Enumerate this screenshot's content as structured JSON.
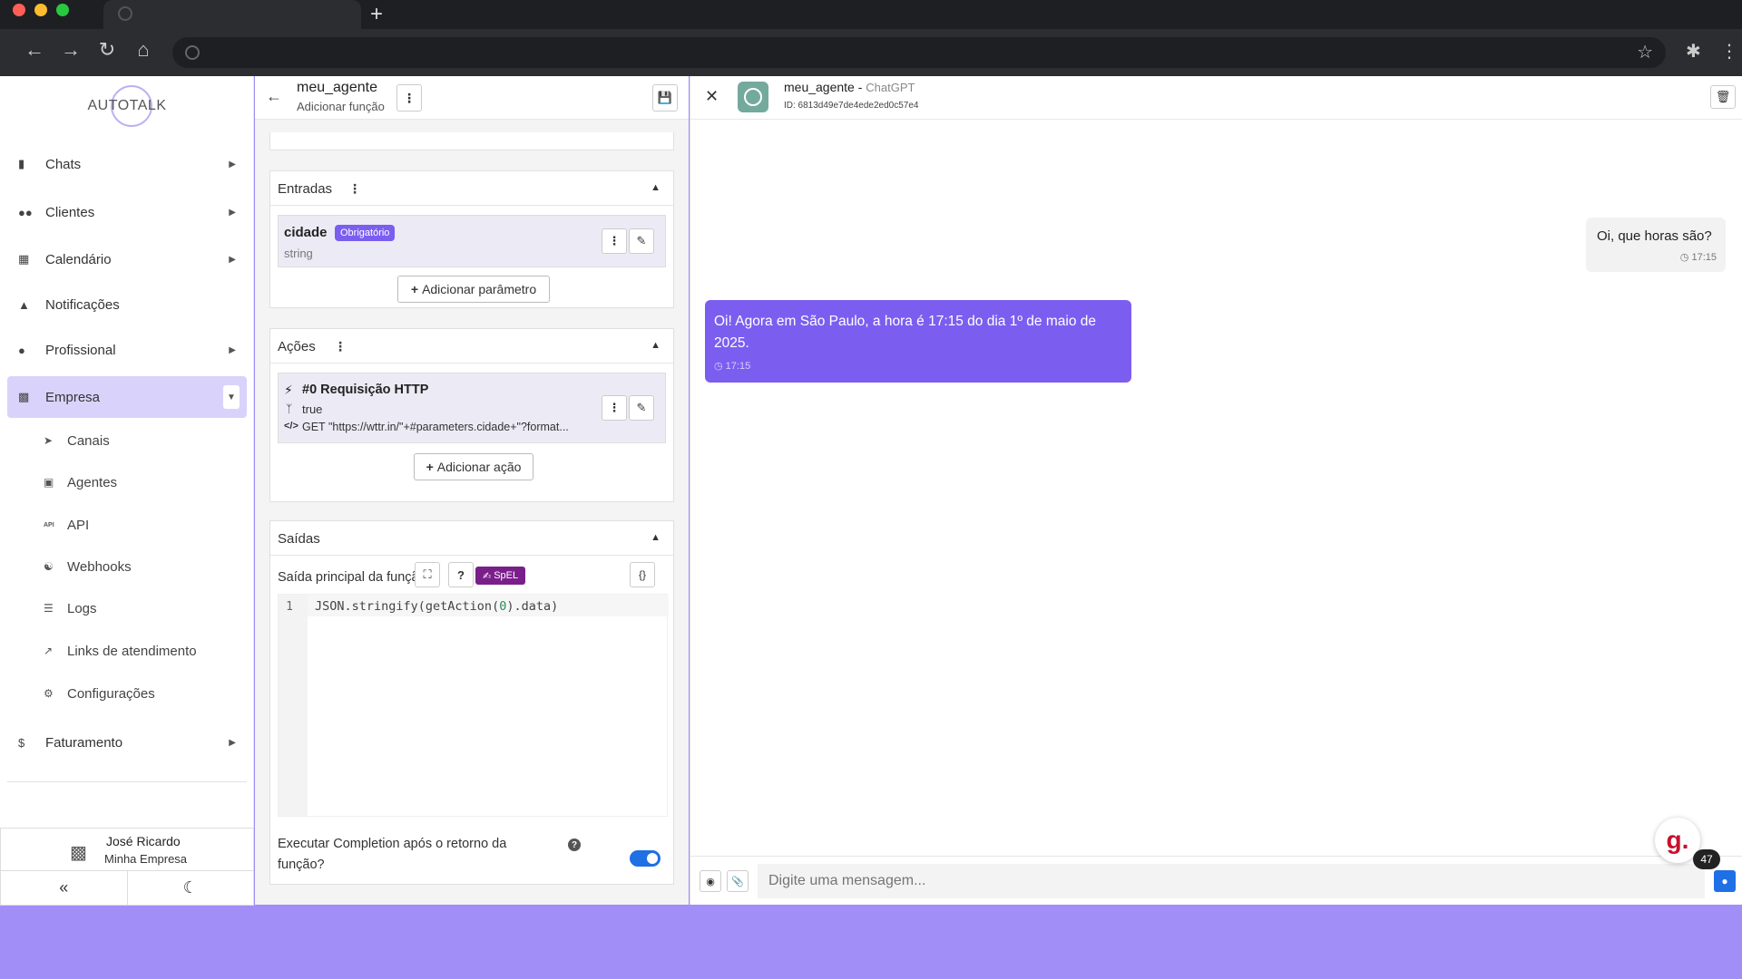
{
  "browser": {
    "icons": [
      "back-icon",
      "forward-icon",
      "reload-icon",
      "home-icon",
      "star-icon",
      "extensions-icon",
      "menu-icon"
    ],
    "dot_colors": [
      "#ff5f57",
      "#febc2e",
      "#28c840"
    ]
  },
  "sidebar": {
    "logo_text": "AUTOTALK",
    "items": [
      {
        "label": "Chats",
        "icon": "chat-icon"
      },
      {
        "label": "Clientes",
        "icon": "users-icon"
      },
      {
        "label": "Calendário",
        "icon": "calendar-icon"
      },
      {
        "label": "Notificações",
        "icon": "bell-icon"
      },
      {
        "label": "Profissional",
        "icon": "user-tie-icon"
      },
      {
        "label": "Empresa",
        "icon": "building-icon"
      }
    ],
    "sub_items": [
      {
        "label": "Canais",
        "icon": "rocket-icon"
      },
      {
        "label": "Agentes",
        "icon": "robot-icon"
      },
      {
        "label": "API",
        "icon": "api-icon"
      },
      {
        "label": "Webhooks",
        "icon": "webhook-icon"
      },
      {
        "label": "Logs",
        "icon": "list-icon"
      },
      {
        "label": "Links de atendimento",
        "icon": "external-link-icon"
      },
      {
        "label": "Configurações",
        "icon": "gear-icon"
      }
    ],
    "billing": {
      "label": "Faturamento",
      "icon": "dollar-icon"
    },
    "user": {
      "name": "José Ricardo",
      "company": "Minha Empresa"
    }
  },
  "editor": {
    "agent_name": "meu_agente",
    "subtitle": "Adicionar função",
    "inputs": {
      "title": "Entradas",
      "param_name": "cidade",
      "param_badge": "Obrigatório",
      "param_type": "string",
      "add_label": "Adicionar parâmetro"
    },
    "actions": {
      "title": "Ações",
      "action_name": "#0 Requisição HTTP",
      "condition": "true",
      "request": "GET \"https://wttr.in/\"+#parameters.cidade+\"?format...",
      "add_label": "Adicionar ação"
    },
    "outputs": {
      "title": "Saídas",
      "main_label": "Saída principal da função",
      "spel_label": "SpEL",
      "line_number": "1",
      "code_pre": "JSON.stringify(getAction(",
      "code_num": "0",
      "code_post": ").data)",
      "completion_label_1": "Executar Completion após o retorno da",
      "completion_label_2": "função?",
      "completion_enabled": true
    }
  },
  "chat": {
    "agent_name": "meu_agente",
    "model": "ChatGPT",
    "id_text": "ID: 6813d49e7de4ede2ed0c57e4",
    "messages": [
      {
        "from": "user",
        "text": "Oi, que horas são?",
        "time": "17:15"
      },
      {
        "from": "bot",
        "text": "Oi! Agora em São Paulo, a hora é 17:15 do dia 1º de maio de 2025.",
        "time": "17:15"
      }
    ],
    "input_placeholder": "Digite uma mensagem...",
    "widget_letter": "g.",
    "widget_count": "47"
  },
  "colors": {
    "accent": "#7b5ef0",
    "page_bg": "#a28ef7",
    "active_nav": "#d9d3fb",
    "toggle": "#1f6fe5"
  }
}
